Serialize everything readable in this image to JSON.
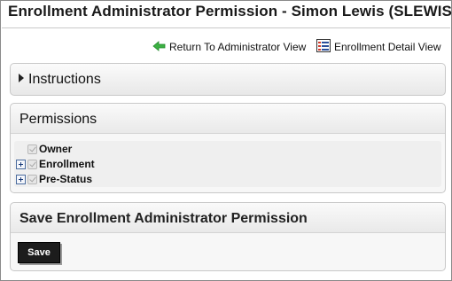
{
  "page": {
    "title": "Enrollment Administrator Permission - Simon Lewis (SLEWIS)"
  },
  "links": {
    "return": {
      "label": "Return To Administrator View",
      "icon": "back-arrow-icon"
    },
    "detail": {
      "label": "Enrollment Detail View",
      "icon": "list-view-icon"
    }
  },
  "instructions": {
    "label": "Instructions",
    "expanded": false
  },
  "permissions": {
    "label": "Permissions",
    "items": [
      {
        "label": "Owner",
        "checked": true,
        "expandable": false
      },
      {
        "label": "Enrollment",
        "checked": true,
        "expandable": true
      },
      {
        "label": "Pre-Status",
        "checked": true,
        "expandable": true
      }
    ]
  },
  "save_section": {
    "label": "Save Enrollment Administrator Permission",
    "button_label": "Save"
  },
  "colors": {
    "save_button_bg": "#1c1c1c",
    "return_icon": "#3cb043",
    "expander_border": "#4b6c9e"
  }
}
